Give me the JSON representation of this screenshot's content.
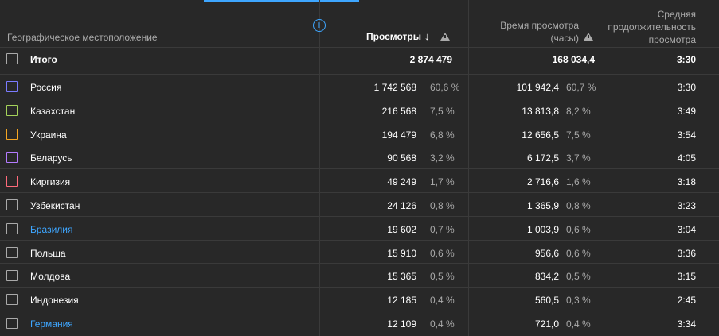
{
  "header": {
    "geo_label": "Географическое местоположение",
    "views_label": "Просмотры",
    "sort_arrow": "↓",
    "watch_time_label_line1": "Время просмотра",
    "watch_time_label_line2": "(часы)",
    "avg_duration_line1": "Средняя",
    "avg_duration_line2": "продолжительность",
    "avg_duration_line3": "просмотра",
    "add_column_icon": "+"
  },
  "total": {
    "label": "Итого",
    "views": "2 874 479",
    "watch_time": "168 034,4",
    "avg_duration": "3:30"
  },
  "rows": [
    {
      "name": "Россия",
      "views": "1 742 568",
      "views_pct": "60,6 %",
      "watch_time": "101 942,4",
      "watch_pct": "60,7 %",
      "avg": "3:30",
      "color": "#7b7bff",
      "link": false
    },
    {
      "name": "Казахстан",
      "views": "216 568",
      "views_pct": "7,5 %",
      "watch_time": "13 813,8",
      "watch_pct": "8,2 %",
      "avg": "3:49",
      "color": "#a5d25a",
      "link": false
    },
    {
      "name": "Украина",
      "views": "194 479",
      "views_pct": "6,8 %",
      "watch_time": "12 656,5",
      "watch_pct": "7,5 %",
      "avg": "3:54",
      "color": "#f5a623",
      "link": false
    },
    {
      "name": "Беларусь",
      "views": "90 568",
      "views_pct": "3,2 %",
      "watch_time": "6 172,5",
      "watch_pct": "3,7 %",
      "avg": "4:05",
      "color": "#b47bff",
      "link": false
    },
    {
      "name": "Киргизия",
      "views": "49 249",
      "views_pct": "1,7 %",
      "watch_time": "2 716,6",
      "watch_pct": "1,6 %",
      "avg": "3:18",
      "color": "#ff6b7b",
      "link": false
    },
    {
      "name": "Узбекистан",
      "views": "24 126",
      "views_pct": "0,8 %",
      "watch_time": "1 365,9",
      "watch_pct": "0,8 %",
      "avg": "3:23",
      "color": "#aaaaaa",
      "link": false
    },
    {
      "name": "Бразилия",
      "views": "19 602",
      "views_pct": "0,7 %",
      "watch_time": "1 003,9",
      "watch_pct": "0,6 %",
      "avg": "3:04",
      "color": "#aaaaaa",
      "link": true
    },
    {
      "name": "Польша",
      "views": "15 910",
      "views_pct": "0,6 %",
      "watch_time": "956,6",
      "watch_pct": "0,6 %",
      "avg": "3:36",
      "color": "#aaaaaa",
      "link": false
    },
    {
      "name": "Молдова",
      "views": "15 365",
      "views_pct": "0,5 %",
      "watch_time": "834,2",
      "watch_pct": "0,5 %",
      "avg": "3:15",
      "color": "#aaaaaa",
      "link": false
    },
    {
      "name": "Индонезия",
      "views": "12 185",
      "views_pct": "0,4 %",
      "watch_time": "560,5",
      "watch_pct": "0,3 %",
      "avg": "2:45",
      "color": "#aaaaaa",
      "link": false
    },
    {
      "name": "Германия",
      "views": "12 109",
      "views_pct": "0,4 %",
      "watch_time": "721,0",
      "watch_pct": "0,4 %",
      "avg": "3:34",
      "color": "#aaaaaa",
      "link": true
    }
  ]
}
